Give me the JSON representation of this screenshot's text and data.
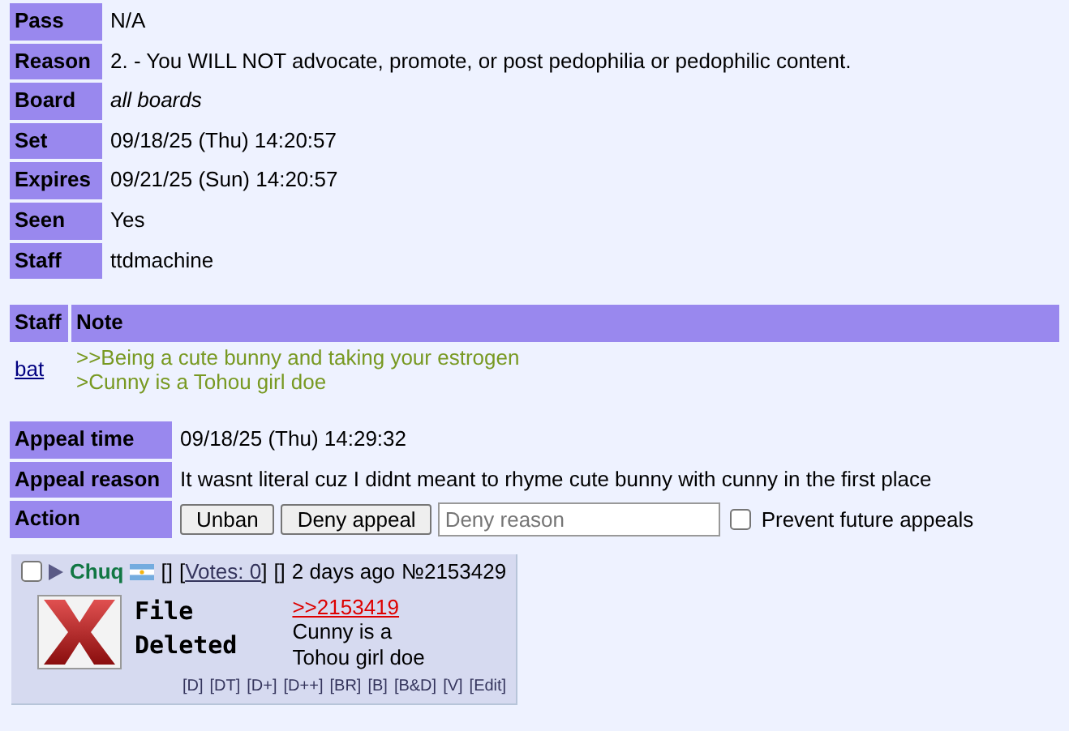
{
  "ban_fields": [
    {
      "label": "Pass",
      "value": "N/A",
      "kind": "plain"
    },
    {
      "label": "Reason",
      "value": "2. - You WILL NOT advocate, promote, or post pedophilia or pedophilic content.",
      "kind": "plain"
    },
    {
      "label": "Board",
      "value": "all boards",
      "kind": "italic"
    },
    {
      "label": "Set",
      "value": "09/18/25 (Thu) 14:20:57",
      "kind": "plain"
    },
    {
      "label": "Expires",
      "value": "09/21/25 (Sun) 14:20:57",
      "kind": "plain"
    },
    {
      "label": "Seen",
      "value": "Yes",
      "kind": "plain"
    },
    {
      "label": "Staff",
      "value": "ttdmachine",
      "kind": "plain"
    }
  ],
  "notes": {
    "columns": [
      "Staff",
      "Note"
    ],
    "rows": [
      {
        "staff": "bat",
        "lines": [
          ">>Being a cute bunny and taking your estrogen",
          ">Cunny is a Tohou girl doe"
        ]
      }
    ]
  },
  "appeal": {
    "fields": [
      {
        "label": "Appeal time",
        "value": "09/18/25 (Thu) 14:29:32"
      },
      {
        "label": "Appeal reason",
        "value": "It wasnt literal cuz I didnt meant to rhyme cute bunny with cunny in the first place"
      }
    ],
    "action_label": "Action",
    "buttons": [
      "Unban",
      "Deny appeal"
    ],
    "deny_placeholder": "Deny reason",
    "prevent": {
      "label": "Prevent future appeals",
      "checked": false
    }
  },
  "post": {
    "checked": false,
    "name": "Chuq",
    "header_parts": [
      {
        "text": "[]",
        "kind": "plain"
      },
      {
        "text": "[",
        "kind": "plain"
      },
      {
        "text": "Votes: 0",
        "kind": "link"
      },
      {
        "text": "]",
        "kind": "plain"
      },
      {
        "text": "[]",
        "kind": "plain"
      }
    ],
    "age": "2 days ago",
    "number": "№2153429",
    "file_text": [
      "File",
      "Deleted"
    ],
    "quote": ">>2153419",
    "message": "Cunny is a Tohou girl doe",
    "mod_links": [
      "[D]",
      "[DT]",
      "[D+]",
      "[D++]",
      "[BR]",
      "[B]",
      "[B&D]",
      "[V]",
      "[Edit]"
    ]
  }
}
